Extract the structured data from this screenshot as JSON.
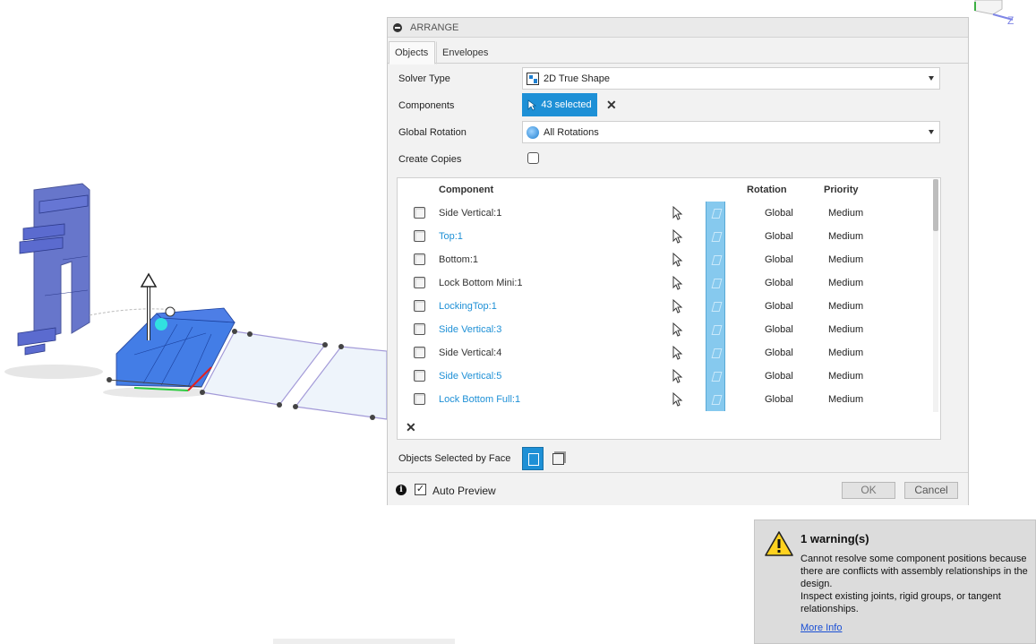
{
  "dialog": {
    "title": "ARRANGE",
    "tabs": [
      {
        "label": "Objects",
        "active": true
      },
      {
        "label": "Envelopes",
        "active": false
      }
    ],
    "solver_type": {
      "label": "Solver Type",
      "value": "2D True Shape",
      "icon": "solver-2d-icon"
    },
    "components": {
      "label": "Components",
      "value": "43 selected"
    },
    "global_rotation": {
      "label": "Global Rotation",
      "value": "All Rotations",
      "icon": "rotation-icon"
    },
    "create_copies": {
      "label": "Create Copies",
      "checked": false
    },
    "table": {
      "headers": {
        "component": "Component",
        "rotation": "Rotation",
        "priority": "Priority"
      },
      "rows": [
        {
          "name": "Side Vertical:1",
          "highlight": false,
          "rotation": "Global",
          "priority": "Medium"
        },
        {
          "name": "Top:1",
          "highlight": true,
          "rotation": "Global",
          "priority": "Medium"
        },
        {
          "name": "Bottom:1",
          "highlight": false,
          "rotation": "Global",
          "priority": "Medium"
        },
        {
          "name": "Lock Bottom Mini:1",
          "highlight": false,
          "rotation": "Global",
          "priority": "Medium"
        },
        {
          "name": "LockingTop:1",
          "highlight": true,
          "rotation": "Global",
          "priority": "Medium"
        },
        {
          "name": "Side Vertical:3",
          "highlight": true,
          "rotation": "Global",
          "priority": "Medium"
        },
        {
          "name": "Side Vertical:4",
          "highlight": false,
          "rotation": "Global",
          "priority": "Medium"
        },
        {
          "name": "Side Vertical:5",
          "highlight": true,
          "rotation": "Global",
          "priority": "Medium"
        },
        {
          "name": "Lock Bottom Full:1",
          "highlight": true,
          "rotation": "Global",
          "priority": "Medium"
        }
      ]
    },
    "objects_selected_by_face": {
      "label": "Objects Selected by Face"
    },
    "footer": {
      "auto_preview": "Auto Preview",
      "auto_preview_checked": true,
      "ok": "OK",
      "cancel": "Cancel"
    }
  },
  "warning": {
    "title": "1 warning(s)",
    "line1": "Cannot resolve some component positions because there are conflicts with assembly relationships in the design.",
    "line2": "Inspect existing joints, rigid groups, or tangent relationships.",
    "link": "More Info"
  },
  "viewcube": {
    "axis_label": "Z"
  },
  "colors": {
    "accent": "#1e90d6",
    "model": "#3c4fb0",
    "selection": "#2a6de0"
  }
}
